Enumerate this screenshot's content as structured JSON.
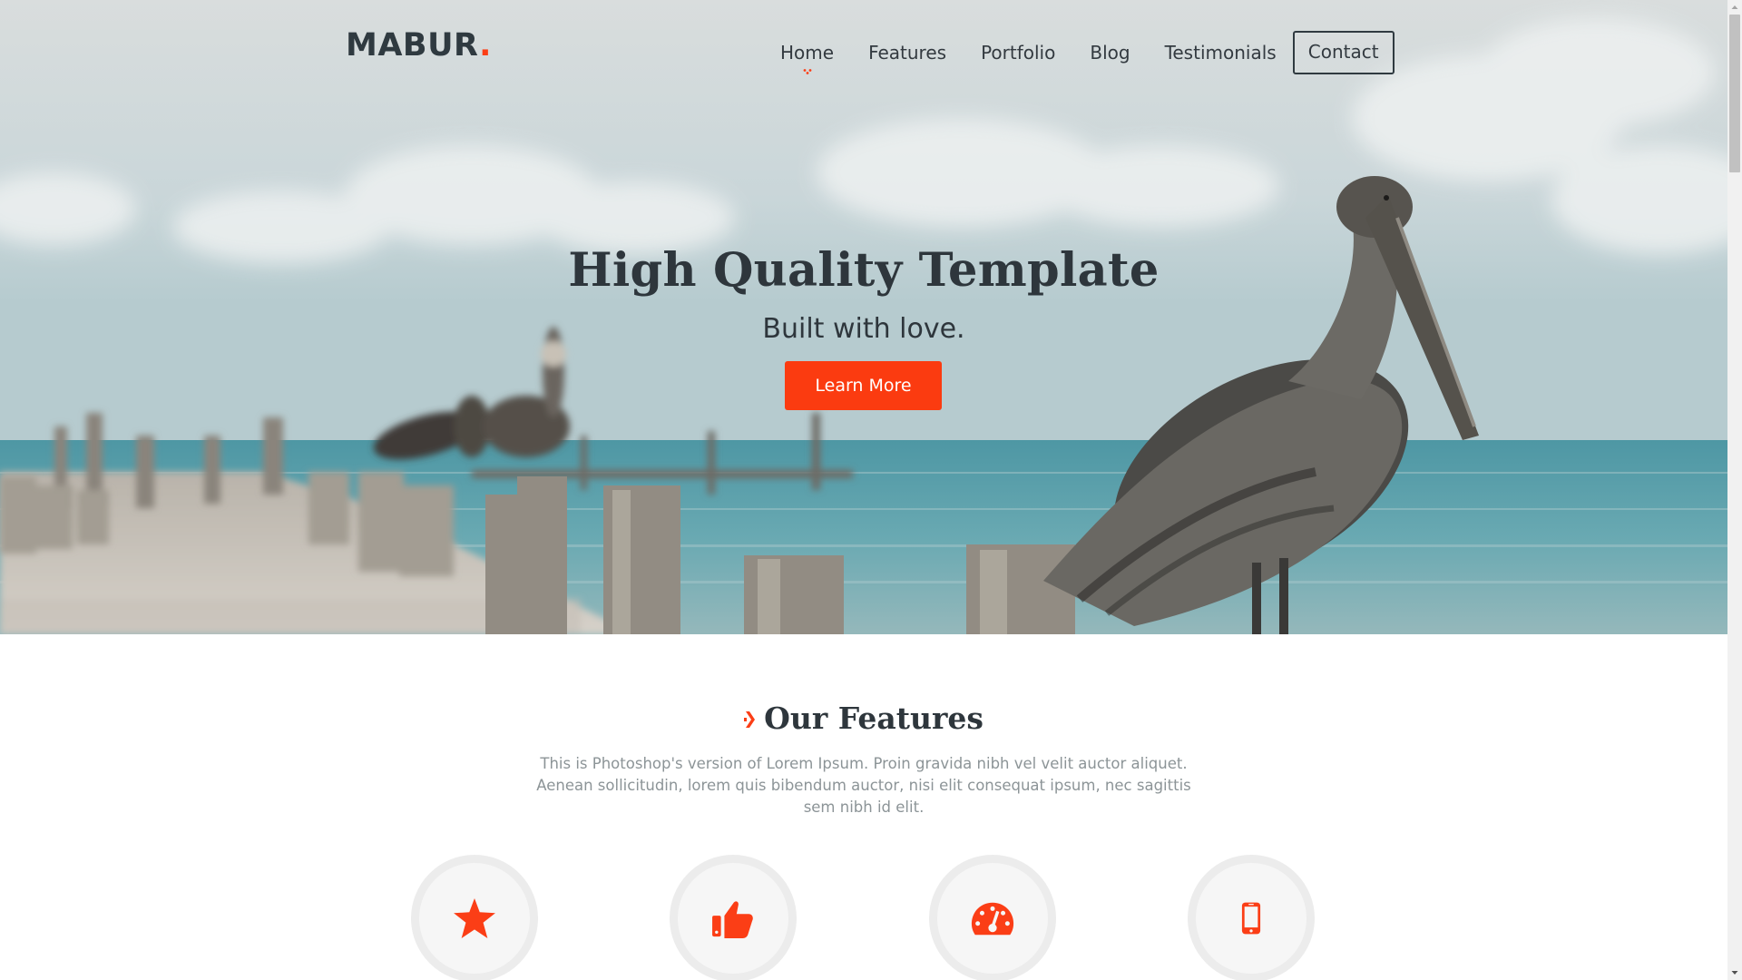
{
  "brand": {
    "name": "MABUR",
    "dot": ".",
    "accent_color": "#fb3e16"
  },
  "nav": {
    "items": [
      {
        "label": "Home",
        "active": true
      },
      {
        "label": "Features"
      },
      {
        "label": "Portfolio"
      },
      {
        "label": "Blog"
      },
      {
        "label": "Testimonials"
      }
    ],
    "contact_label": "Contact"
  },
  "hero": {
    "title": "High Quality Template",
    "subtitle": "Built with love.",
    "cta_label": "Learn More",
    "background_image": "pelicans-on-pier"
  },
  "features": {
    "title": "Our Features",
    "description": "This is Photoshop's version of Lorem Ipsum. Proin gravida nibh vel velit auctor aliquet. Aenean sollicitudin, lorem quis bibendum auctor, nisi elit consequat ipsum, nec sagittis sem nibh id elit.",
    "icons": [
      "star-icon",
      "thumbs-up-icon",
      "dashboard-gauge-icon",
      "mobile-phone-icon"
    ]
  },
  "colors": {
    "accent": "#fb3b10",
    "text_dark": "#2e363c",
    "text_muted": "#8c9497"
  }
}
